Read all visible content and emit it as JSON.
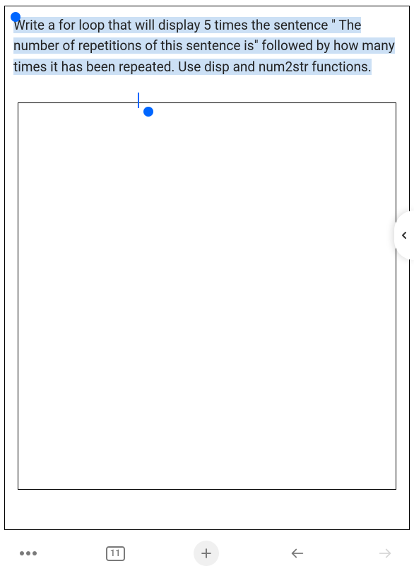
{
  "question": {
    "text": "Write a for loop that will display 5 times the sentence \" The number of repetitions of this sentence is\" followed by how many times it has been repeated. Use disp and num2str functions."
  },
  "toolbar": {
    "page_number": "11"
  }
}
